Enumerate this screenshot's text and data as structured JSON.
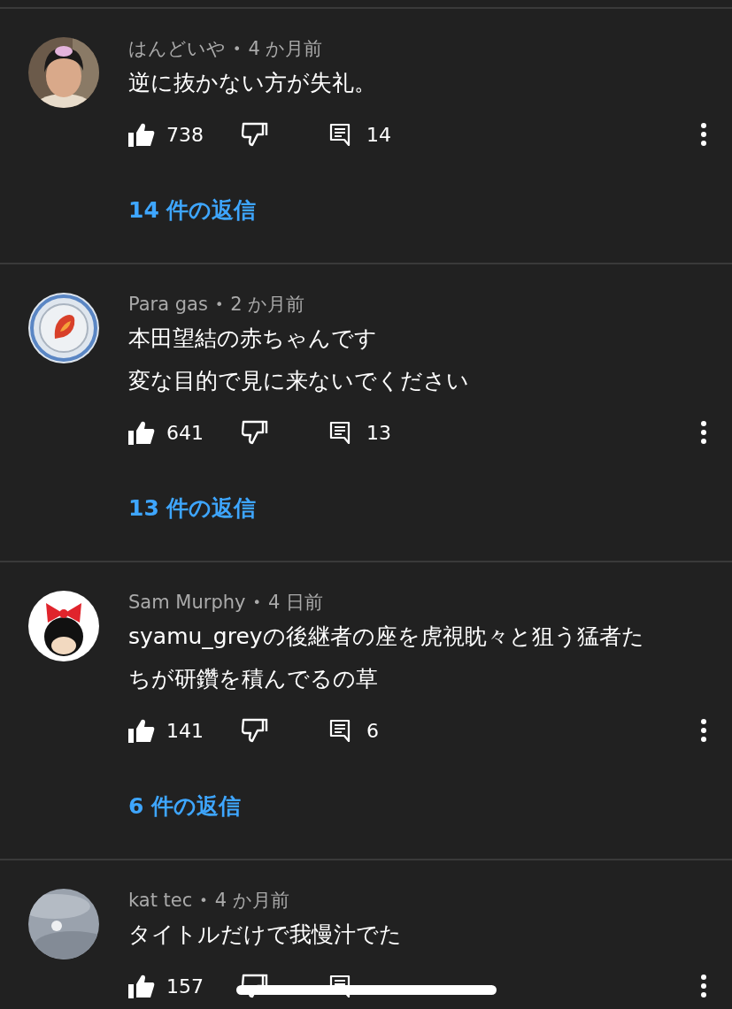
{
  "comments": [
    {
      "avatar": {
        "kind": "person"
      },
      "author": "はんどいや",
      "separator": "•",
      "time": "4 か月前",
      "lines": [
        "逆に抜かない方が失礼。"
      ],
      "likes": "738",
      "reply_count": "14",
      "replies_link": "14 件の返信"
    },
    {
      "avatar": {
        "kind": "emblem"
      },
      "author": "Para gas",
      "separator": "•",
      "time": "2 か月前",
      "lines": [
        "本田望結の赤ちゃんです",
        "変な目的で見に来ないでください"
      ],
      "likes": "641",
      "reply_count": "13",
      "replies_link": "13 件の返信"
    },
    {
      "avatar": {
        "kind": "bow"
      },
      "author": "Sam Murphy",
      "separator": "•",
      "time": "4 日前",
      "lines": [
        "syamu_greyの後継者の座を虎視眈々と狙う猛者た",
        "ちが研鑽を積んでるの草"
      ],
      "likes": "141",
      "reply_count": "6",
      "replies_link": "6 件の返信"
    },
    {
      "avatar": {
        "kind": "sky"
      },
      "author": "kat tec",
      "separator": "•",
      "time": "4 か月前",
      "lines": [
        "タイトルだけで我慢汁でた"
      ],
      "likes": "157"
    }
  ]
}
